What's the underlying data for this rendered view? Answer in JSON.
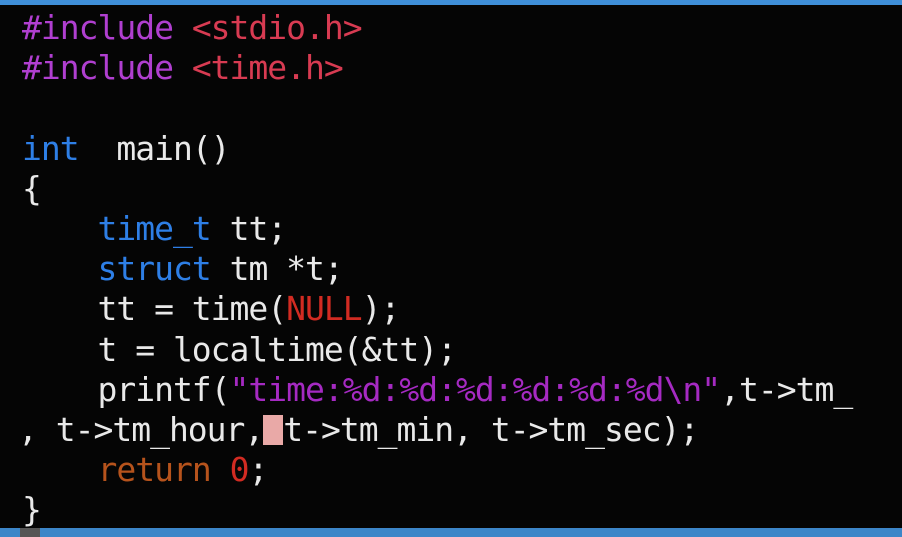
{
  "editor": {
    "lines": [
      {
        "tokens": [
          {
            "t": "#include ",
            "c": "preproc"
          },
          {
            "t": "<stdio.h>",
            "c": "header-file"
          }
        ]
      },
      {
        "tokens": [
          {
            "t": "#include ",
            "c": "preproc"
          },
          {
            "t": "<time.h>",
            "c": "header-file"
          }
        ]
      },
      {
        "tokens": []
      },
      {
        "tokens": [
          {
            "t": "int",
            "c": "kw-type"
          },
          {
            "t": "  main()",
            "c": "plain"
          }
        ]
      },
      {
        "tokens": [
          {
            "t": "{",
            "c": "plain"
          }
        ]
      },
      {
        "tokens": [
          {
            "t": "    ",
            "c": "plain"
          },
          {
            "t": "time_t",
            "c": "kw-type"
          },
          {
            "t": " tt;",
            "c": "plain"
          }
        ]
      },
      {
        "tokens": [
          {
            "t": "    ",
            "c": "plain"
          },
          {
            "t": "struct",
            "c": "kw-type"
          },
          {
            "t": " tm *t;",
            "c": "plain"
          }
        ]
      },
      {
        "tokens": [
          {
            "t": "    tt = time(",
            "c": "plain"
          },
          {
            "t": "NULL",
            "c": "null"
          },
          {
            "t": ");",
            "c": "plain"
          }
        ]
      },
      {
        "tokens": [
          {
            "t": "    t = localtime(&tt);",
            "c": "plain"
          }
        ]
      },
      {
        "tokens": [
          {
            "t": "    printf(",
            "c": "plain"
          },
          {
            "t": "\"time:%d:%d:%d:%d:%d:%d\\n\"",
            "c": "str"
          },
          {
            "t": ",t->tm_",
            "c": "plain"
          }
        ]
      },
      {
        "tokens": [
          {
            "t": ", t->tm_hour,",
            "c": "plain"
          },
          {
            "t": "",
            "c": "cursor"
          },
          {
            "t": "t->tm_min, t->tm_sec);",
            "c": "plain"
          }
        ],
        "continuation": true
      },
      {
        "tokens": [
          {
            "t": "    ",
            "c": "plain"
          },
          {
            "t": "return",
            "c": "ret"
          },
          {
            "t": " ",
            "c": "plain"
          },
          {
            "t": "0",
            "c": "num"
          },
          {
            "t": ";",
            "c": "plain"
          }
        ]
      },
      {
        "tokens": [
          {
            "t": "}",
            "c": "plain"
          }
        ]
      }
    ]
  },
  "colors": {
    "background": "#050505",
    "preprocessor": "#b03fd0",
    "header_file": "#d83b52",
    "type_keyword": "#2e7fe6",
    "string": "#a52ac2",
    "null_constant": "#d22b22",
    "return_keyword": "#b6531c",
    "cursor": "#e9a9a7",
    "status_bar": "#3c86c8"
  }
}
